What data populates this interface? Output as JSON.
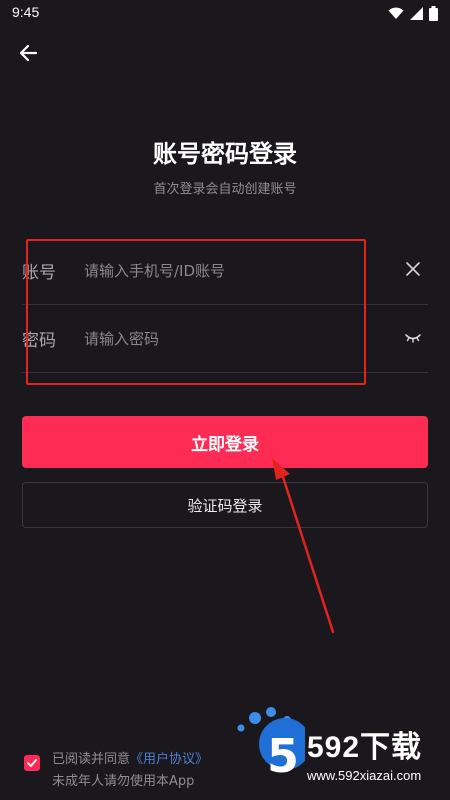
{
  "status_bar": {
    "time": "9:45"
  },
  "page": {
    "title": "账号密码登录",
    "subtitle": "首次登录会自动创建账号"
  },
  "account_field": {
    "label": "账号",
    "placeholder": "请输入手机号/ID账号",
    "value": ""
  },
  "password_field": {
    "label": "密码",
    "placeholder": "请输入密码",
    "value": ""
  },
  "buttons": {
    "login_label": "立即登录",
    "sms_login_label": "验证码登录"
  },
  "agreement": {
    "prefix": "已阅读并同意",
    "link": "《用户协议》",
    "line2": "未成年人请勿使用本App",
    "checked": true
  },
  "watermark": {
    "brand": "592下载",
    "url": "www.592xiazai.com"
  },
  "colors": {
    "background": "#1a181c",
    "accent": "#fe2c55",
    "annotation_red": "#e2231f",
    "link_blue": "#4f7fd0"
  },
  "icons": {
    "back": "arrow-left-icon",
    "clear": "close-icon",
    "password_visibility": "eye-closed-icon",
    "wifi": "wifi-icon",
    "signal": "signal-icon",
    "battery": "battery-icon"
  }
}
